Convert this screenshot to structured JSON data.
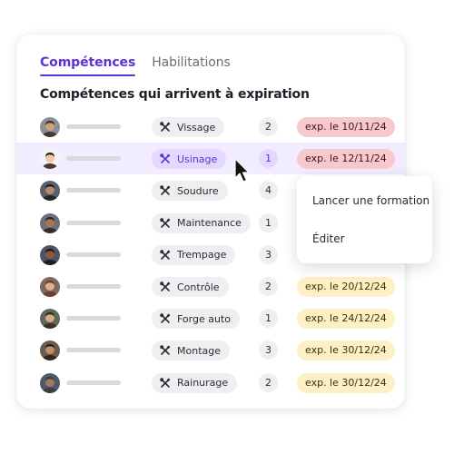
{
  "tabs": [
    {
      "label": "Compétences",
      "active": true
    },
    {
      "label": "Habilitations",
      "active": false
    }
  ],
  "section_title": "Compétences qui arrivent à expiration",
  "rows": [
    {
      "skill": "Vissage",
      "count": "2",
      "expiry": "exp. le 10/11/24",
      "status": "expired",
      "selected": false
    },
    {
      "skill": "Usinage",
      "count": "1",
      "expiry": "exp. le 12/11/24",
      "status": "expired",
      "selected": true
    },
    {
      "skill": "Soudure",
      "count": "4",
      "expiry": "",
      "status": "expired",
      "selected": false
    },
    {
      "skill": "Maintenance",
      "count": "1",
      "expiry": "",
      "status": "expired",
      "selected": false
    },
    {
      "skill": "Trempage",
      "count": "3",
      "expiry": "",
      "status": "upcoming",
      "selected": false
    },
    {
      "skill": "Contrôle",
      "count": "2",
      "expiry": "exp. le 20/12/24",
      "status": "upcoming",
      "selected": false
    },
    {
      "skill": "Forge auto",
      "count": "1",
      "expiry": "exp. le 24/12/24",
      "status": "upcoming",
      "selected": false
    },
    {
      "skill": "Montage",
      "count": "3",
      "expiry": "exp. le 30/12/24",
      "status": "upcoming",
      "selected": false
    },
    {
      "skill": "Rainurage",
      "count": "2",
      "expiry": "exp. le 30/12/24",
      "status": "upcoming",
      "selected": false
    }
  ],
  "skill_icon": "tools-icon",
  "context_menu": {
    "items": [
      "Lancer une formation",
      "Éditer"
    ]
  },
  "colors": {
    "accent": "#5b33d6",
    "row_highlight": "#f1ecff",
    "expired_badge": "#f7c9cc",
    "upcoming_badge": "#fdf0c4"
  }
}
